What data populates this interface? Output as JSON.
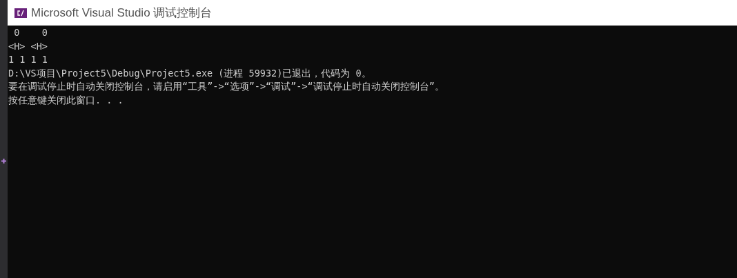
{
  "window": {
    "title": "Microsoft Visual Studio 调试控制台"
  },
  "console_lines": [
    " 0    0",
    "<H> <H>",
    "1 1 1 1",
    "D:\\VS项目\\Project5\\Debug\\Project5.exe (进程 59932)已退出，代码为 0。",
    "要在调试停止时自动关闭控制台，请启用“工具”->“选项”->“调试”->“调试停止时自动关闭控制台”。",
    "按任意键关闭此窗口. . ."
  ]
}
